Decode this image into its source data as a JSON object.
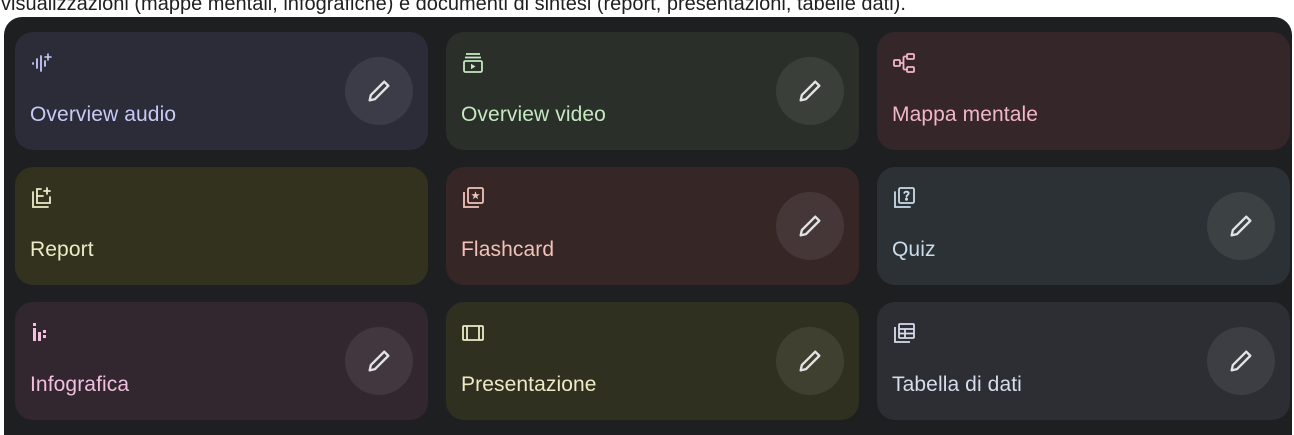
{
  "caption": "visualizzazioni (mappe mentali, infografiche) e documenti di sintesi (report, presentazioni, tabelle dati).",
  "cards": [
    {
      "label": "Overview audio",
      "icon": "audio-sparkle-icon",
      "has_edit": true,
      "bg": "#2b2c38",
      "fg": "#c6cbf5",
      "iconColor": "#c6cbf5"
    },
    {
      "label": "Overview video",
      "icon": "video-icon",
      "has_edit": true,
      "bg": "#2a2f2a",
      "fg": "#c4e8c0",
      "iconColor": "#c4e8c0"
    },
    {
      "label": "Mappa mentale",
      "icon": "mind-map-icon",
      "has_edit": false,
      "bg": "#342629",
      "fg": "#f3b6c6",
      "iconColor": "#f3b6c6"
    },
    {
      "label": "Report",
      "icon": "report-icon",
      "has_edit": false,
      "bg": "#33321f",
      "fg": "#ecebc6",
      "iconColor": "#ecebc6"
    },
    {
      "label": "Flashcard",
      "icon": "flashcard-icon",
      "has_edit": true,
      "bg": "#362626",
      "fg": "#f0c3b8",
      "iconColor": "#f0c3b8"
    },
    {
      "label": "Quiz",
      "icon": "quiz-icon",
      "has_edit": true,
      "bg": "#2c3135",
      "fg": "#c9dce9",
      "iconColor": "#c9dce9"
    },
    {
      "label": "Infografica",
      "icon": "infographic-icon",
      "has_edit": true,
      "bg": "#32262f",
      "fg": "#f1bfe0",
      "iconColor": "#f1bfe0"
    },
    {
      "label": "Presentazione",
      "icon": "presentation-icon",
      "has_edit": true,
      "bg": "#303020",
      "fg": "#ecebc6",
      "iconColor": "#ecebc6"
    },
    {
      "label": "Tabella di dati",
      "icon": "data-table-icon",
      "has_edit": true,
      "bg": "#2c2e33",
      "fg": "#d6dcec",
      "iconColor": "#d6dcec"
    }
  ],
  "edit_icon": "pencil-icon",
  "colors": {
    "panel_bg": "#1e1f20",
    "edit_bg": "#3a3b3e",
    "pencil": "#e3e3e3"
  }
}
